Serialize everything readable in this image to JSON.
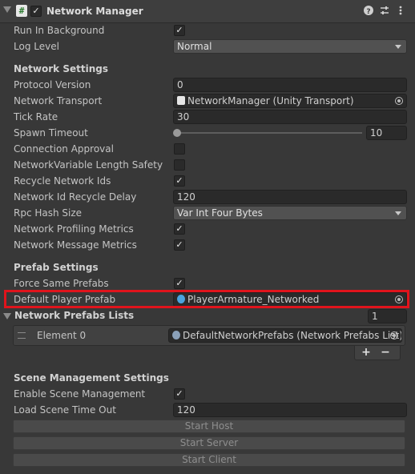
{
  "component": {
    "title": "Network Manager",
    "enabled": true,
    "icons": [
      "help-icon",
      "presets-icon",
      "more-options-icon"
    ]
  },
  "top": {
    "run_in_background": {
      "label": "Run In Background",
      "checked": true
    },
    "log_level": {
      "label": "Log Level",
      "value": "Normal"
    }
  },
  "network_settings": {
    "header": "Network Settings",
    "protocol_version": {
      "label": "Protocol Version",
      "value": "0"
    },
    "network_transport": {
      "label": "Network Transport",
      "value": "NetworkManager (Unity Transport)"
    },
    "tick_rate": {
      "label": "Tick Rate",
      "value": "30"
    },
    "spawn_timeout": {
      "label": "Spawn Timeout",
      "value": "10"
    },
    "connection_approval": {
      "label": "Connection Approval",
      "checked": false
    },
    "nv_length_safety": {
      "label": "NetworkVariable Length Safety",
      "checked": false
    },
    "recycle_ids": {
      "label": "Recycle Network Ids",
      "checked": true
    },
    "recycle_delay": {
      "label": "Network Id Recycle Delay",
      "value": "120"
    },
    "rpc_hash_size": {
      "label": "Rpc Hash Size",
      "value": "Var Int Four Bytes"
    },
    "profiling_metrics": {
      "label": "Network Profiling Metrics",
      "checked": true
    },
    "message_metrics": {
      "label": "Network Message Metrics",
      "checked": true
    }
  },
  "prefab_settings": {
    "header": "Prefab Settings",
    "force_same": {
      "label": "Force Same Prefabs",
      "checked": true
    },
    "default_player": {
      "label": "Default Player Prefab",
      "value": "PlayerArmature_Networked"
    },
    "lists": {
      "label": "Network Prefabs Lists",
      "count": "1"
    },
    "element0": {
      "label": "Element 0",
      "value": "DefaultNetworkPrefabs (Network Prefabs List)"
    },
    "add": "+",
    "remove": "−"
  },
  "scene_settings": {
    "header": "Scene Management Settings",
    "enable": {
      "label": "Enable Scene Management",
      "checked": true
    },
    "timeout": {
      "label": "Load Scene Time Out",
      "value": "120"
    }
  },
  "buttons": {
    "start_host": "Start Host",
    "start_server": "Start Server",
    "start_client": "Start Client"
  },
  "colors": {
    "highlight": "#e0141c",
    "background": "#383838"
  }
}
